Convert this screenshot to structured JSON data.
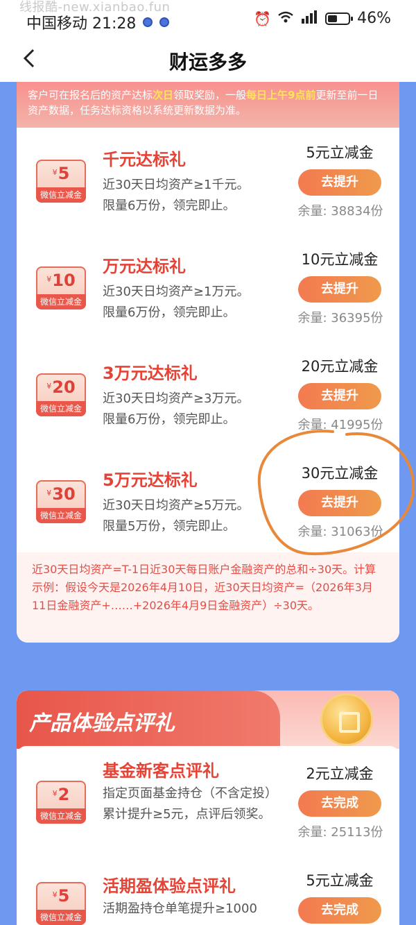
{
  "watermark": "线报酷-new.xianbao.fun",
  "status_bar": {
    "carrier_time": "中国移动 21:28",
    "battery": "46%",
    "battery_level": 0.46
  },
  "nav": {
    "back_icon": "chevron-left-icon",
    "title": "财运多多"
  },
  "notice": {
    "part1": "客户可在报名后的资产达标",
    "hl1": "次日",
    "part2": "领取奖励，一般",
    "hl2": "每日上午9点前",
    "part3": "更新至前一日资产数据，任务达标资格以系统更新数据为准。"
  },
  "asset_items": [
    {
      "coupon_amount": "5",
      "coupon_label": "微信立减金",
      "title": "千元达标礼",
      "desc1": "近30天日均资产≥1千元。",
      "desc2": "限量6万份，领完即止。",
      "reward": "5元立减金",
      "button": "去提升",
      "remaining": "余量: 38834份"
    },
    {
      "coupon_amount": "10",
      "coupon_label": "微信立减金",
      "title": "万元达标礼",
      "desc1": "近30天日均资产≥1万元。",
      "desc2": "限量6万份，领完即止。",
      "reward": "10元立减金",
      "button": "去提升",
      "remaining": "余量: 36395份"
    },
    {
      "coupon_amount": "20",
      "coupon_label": "微信立减金",
      "title": "3万元达标礼",
      "desc1": "近30天日均资产≥3万元。",
      "desc2": "限量6万份，领完即止。",
      "reward": "20元立减金",
      "button": "去提升",
      "remaining": "余量: 41995份"
    },
    {
      "coupon_amount": "30",
      "coupon_label": "微信立减金",
      "title": "5万元达标礼",
      "desc1": "近30天日均资产≥5万元。",
      "desc2": "限量5万份，领完即止。",
      "reward": "30元立减金",
      "button": "去提升",
      "remaining": "余量: 31063份"
    }
  ],
  "formula": "近30天日均资产=T-1日近30天每日账户金融资产的总和÷30天。计算示例：假设今天是2026年4月10日，近30天日均资产=（2026年3月11日金融资产+……+2026年4月9日金融资产）÷30天。",
  "section2": {
    "title": "产品体验点评礼",
    "items": [
      {
        "coupon_amount": "2",
        "coupon_label": "微信立减金",
        "title": "基金新客点评礼",
        "desc": "指定页面基金持仓（不含定投）累计提升≥5元，点评后领奖。",
        "reward": "2元立减金",
        "button": "去完成",
        "remaining": "余量: 25113份"
      },
      {
        "coupon_amount": "5",
        "coupon_label": "微信立减金",
        "title": "活期盈体验点评礼",
        "desc": "活期盈持仓单笔提升≥1000",
        "reward": "5元立减金",
        "button": "去完成"
      }
    ]
  },
  "colors": {
    "accent_red": "#e54336",
    "button_orange": "#f37a50",
    "background_blue": "#6f98f0"
  }
}
